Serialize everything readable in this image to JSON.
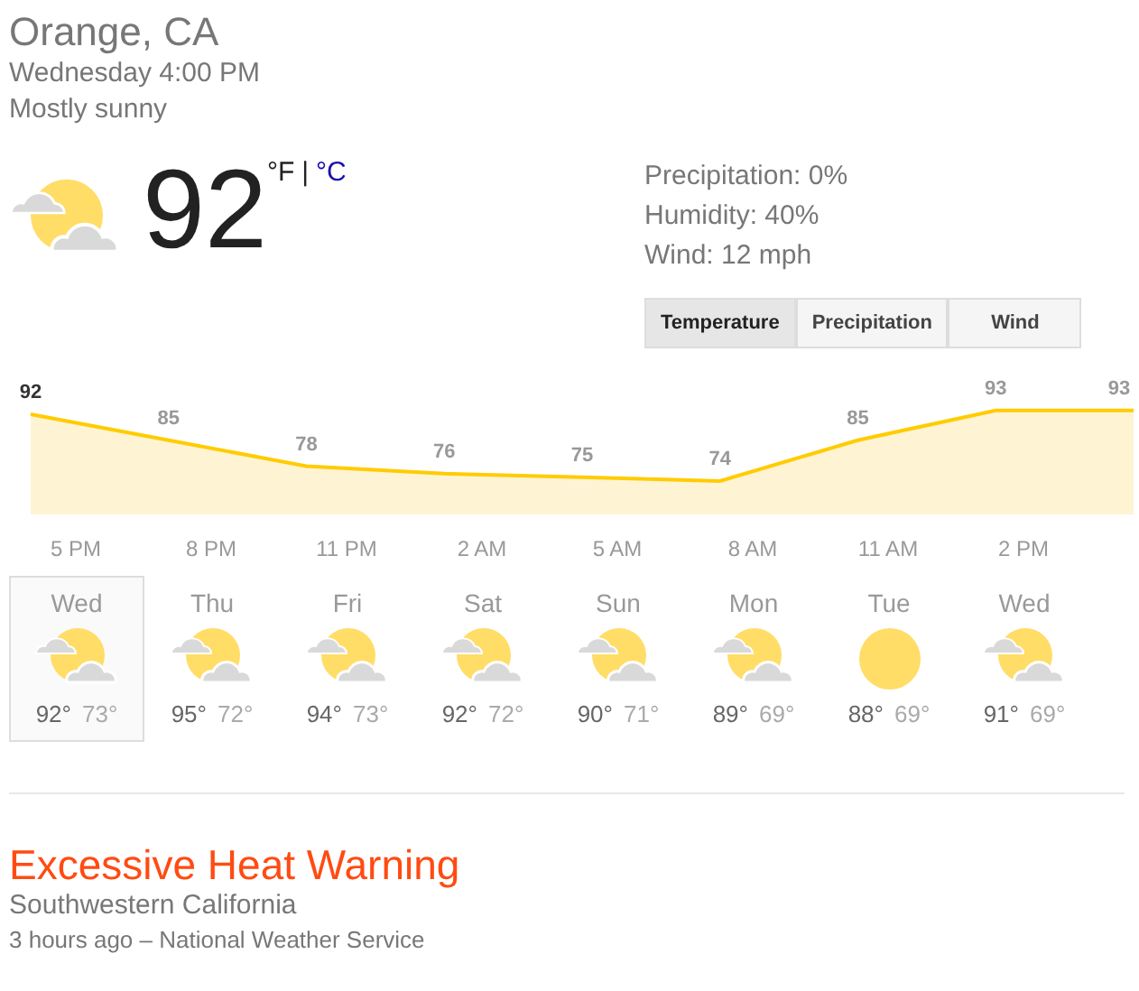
{
  "location": "Orange, CA",
  "datetime": "Wednesday 4:00 PM",
  "condition": "Mostly sunny",
  "current": {
    "kind": "partly_cloudy",
    "temperature": "92",
    "units": [
      {
        "label": "°F",
        "selected": true
      },
      {
        "label": "°C",
        "selected": false
      }
    ],
    "unit_separator": "|"
  },
  "details": [
    "Precipitation: 0%",
    "Humidity: 40%",
    "Wind: 12 mph"
  ],
  "tabs": [
    {
      "label": "Temperature",
      "selected": true
    },
    {
      "label": "Precipitation",
      "selected": false
    },
    {
      "label": "Wind",
      "selected": false
    }
  ],
  "chart": {
    "chart_data": {
      "type": "area",
      "categories": [
        null,
        null,
        null,
        null,
        null,
        null,
        null,
        null,
        null
      ],
      "series": [
        {
          "color": "#ffcc00",
          "values": [
            92,
            85,
            78,
            76,
            75,
            74,
            85,
            93,
            93
          ]
        }
      ],
      "data_labels": true
    },
    "hour_labels": [
      "5 PM",
      "8 PM",
      "11 PM",
      "2 AM",
      "5 AM",
      "8 AM",
      "11 AM",
      "2 PM"
    ]
  },
  "days": [
    {
      "day": "Wed",
      "kind": "partly_cloudy",
      "high": "92°",
      "low": "73°",
      "selected": true
    },
    {
      "day": "Thu",
      "kind": "partly_cloudy",
      "high": "95°",
      "low": "72°",
      "selected": false
    },
    {
      "day": "Fri",
      "kind": "partly_cloudy",
      "high": "94°",
      "low": "73°",
      "selected": false
    },
    {
      "day": "Sat",
      "kind": "partly_cloudy",
      "high": "92°",
      "low": "72°",
      "selected": false
    },
    {
      "day": "Sun",
      "kind": "partly_cloudy",
      "high": "90°",
      "low": "71°",
      "selected": false
    },
    {
      "day": "Mon",
      "kind": "partly_cloudy",
      "high": "89°",
      "low": "69°",
      "selected": false
    },
    {
      "day": "Tue",
      "kind": "sunny",
      "high": "88°",
      "low": "69°",
      "selected": false
    },
    {
      "day": "Wed",
      "kind": "partly_cloudy",
      "high": "91°",
      "low": "69°",
      "selected": false
    }
  ],
  "alert": {
    "title": "Excessive Heat Warning",
    "region": "Southwestern California",
    "source": "3 hours ago – National Weather Service"
  }
}
